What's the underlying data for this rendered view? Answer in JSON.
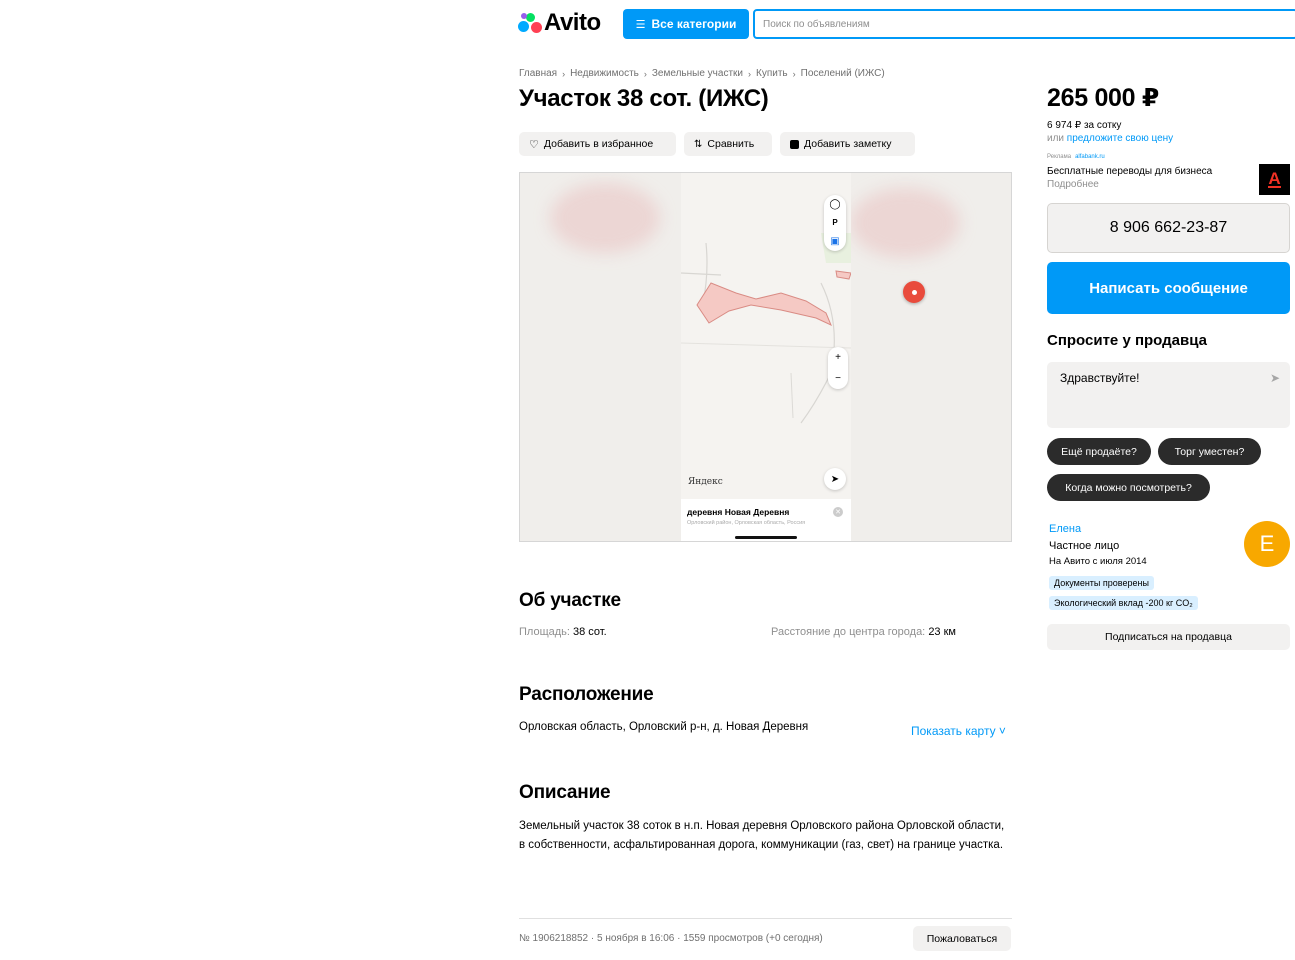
{
  "header": {
    "logo_text": "Avito",
    "categories_button": "Все категории",
    "search_placeholder": "Поиск по объявлениям"
  },
  "breadcrumb": [
    "Главная",
    "Недвижимость",
    "Земельные участки",
    "Купить",
    "Поселений (ИЖС)"
  ],
  "listing": {
    "title": "Участок 38 сот. (ИЖС)",
    "actions": {
      "favorite": "Добавить в избранное",
      "compare": "Сравнить",
      "note": "Добавить заметку"
    }
  },
  "map": {
    "provider": "Яндекс",
    "place_title": "деревня Новая Деревня",
    "place_subtitle": "Орловский район, Орловская область, Россия",
    "zoom_in": "+",
    "zoom_out": "−"
  },
  "about": {
    "heading": "Об участке",
    "area_label": "Площадь:",
    "area_value": "38 сот.",
    "distance_label": "Расстояние до центра города:",
    "distance_value": "23 км"
  },
  "location": {
    "heading": "Расположение",
    "address": "Орловская область, Орловский р-н, д. Новая Деревня",
    "show_map": "Показать карту ˅"
  },
  "description": {
    "heading": "Описание",
    "text": "Земельный участок 38 соток в н.п. Новая деревня Орловского района Орловской области, в собственности, асфальтированная дорога, коммуникации (газ, свет) на границе участка."
  },
  "footer": {
    "meta": "№ 1906218852 · 5 ноября в 16:06 · 1559 просмотров (+0 сегодня)",
    "complain": "Пожаловаться"
  },
  "sidebar": {
    "price": "265 000 ₽",
    "price_per": "6 974 ₽ за сотку",
    "offer_prefix": "или",
    "offer_link": "предложите свою цену",
    "ad_label": "Реклама",
    "ad_source": "alfabank.ru",
    "ad_title": "Бесплатные переводы для бизнеса",
    "ad_more": "Подробнее",
    "ad_logo": "A",
    "phone": "8 906 662-23-87",
    "message_button": "Написать сообщение",
    "ask_heading": "Спросите у продавца",
    "ask_text": "Здравствуйте!",
    "chips": [
      "Ещё продаёте?",
      "Торг уместен?",
      "Когда можно посмотреть?"
    ],
    "seller": {
      "name": "Елена",
      "type": "Частное лицо",
      "since": "На Авито с июля 2014",
      "avatar_letter": "Е",
      "badges": [
        "Документы проверены",
        "Экологический вклад -200 кг CO₂"
      ]
    },
    "subscribe": "Подписаться на продавца"
  },
  "colors": {
    "accent": "#0099f7",
    "avatar": "#f8a800",
    "map_pin": "#e94b3c",
    "chip_bg": "#2b2b2b"
  }
}
